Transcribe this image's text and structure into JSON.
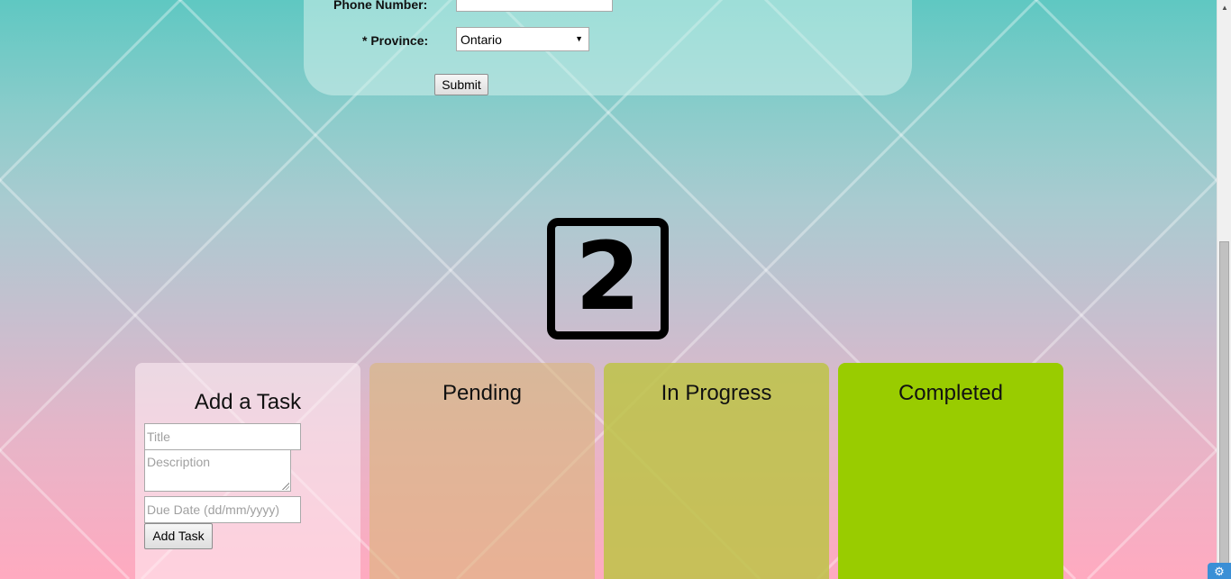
{
  "form": {
    "phone_label": "Phone Number:",
    "province_label": "* Province:",
    "phone_value": "",
    "province_selected": "Ontario",
    "submit_label": "Submit"
  },
  "badge": {
    "number": "2"
  },
  "columns": {
    "add_task": {
      "title": "Add a Task",
      "title_placeholder": "Title",
      "description_placeholder": "Description",
      "due_date_placeholder": "Due Date (dd/mm/yyyy)",
      "add_button_label": "Add Task"
    },
    "pending": {
      "title": "Pending"
    },
    "in_progress": {
      "title": "In Progress"
    },
    "completed": {
      "title": "Completed"
    }
  },
  "icons": {
    "select_arrow": "caret-down-icon",
    "scroll_up": "scroll-up-arrow-icon",
    "corner": "widget-icon"
  },
  "colors": {
    "pending": "#dab678",
    "in_progress": "#bdc346",
    "completed": "#99cc00"
  }
}
